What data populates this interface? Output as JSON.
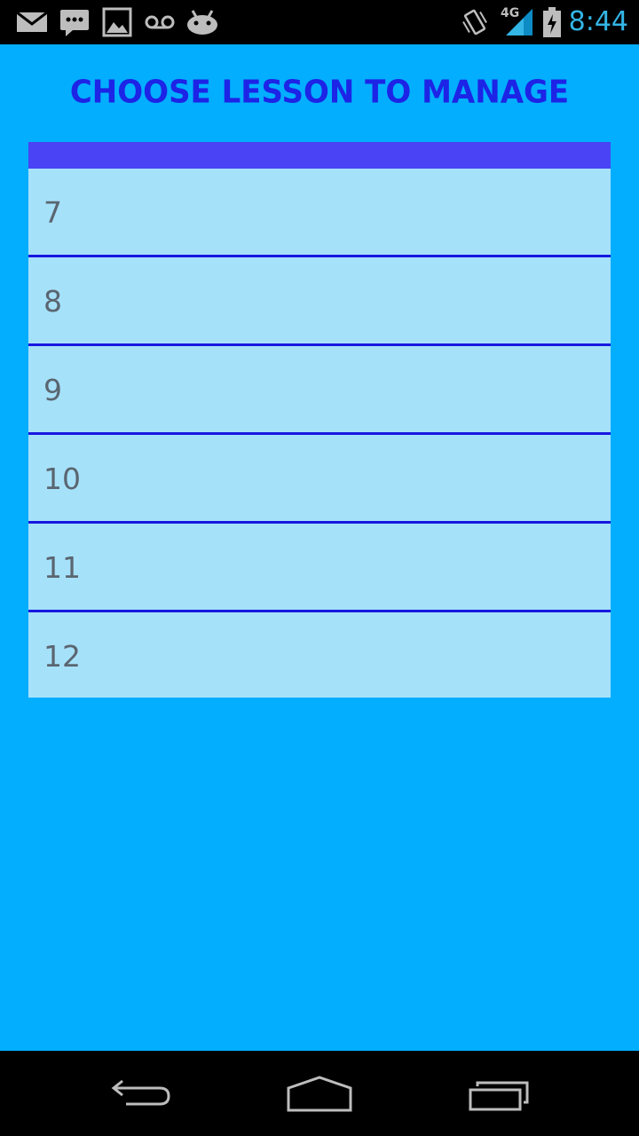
{
  "status_bar": {
    "time": "8:44",
    "network": "4G",
    "icons": [
      "mail-icon",
      "chat-icon",
      "image-icon",
      "voicemail-icon",
      "android-icon",
      "vibrate-icon",
      "signal-icon",
      "battery-charging-icon"
    ]
  },
  "page": {
    "title": "CHOOSE LESSON TO MANAGE"
  },
  "lessons": [
    "7",
    "8",
    "9",
    "10",
    "11",
    "12"
  ],
  "nav_bar": {
    "icons": [
      "back-icon",
      "home-icon",
      "recent-apps-icon"
    ]
  },
  "colors": {
    "background": "#03aeff",
    "title": "#1d24e6",
    "list_header": "#4a42f5",
    "list_item": "#a6e1fa",
    "divider": "#1818e0",
    "clock": "#33b5e5"
  }
}
